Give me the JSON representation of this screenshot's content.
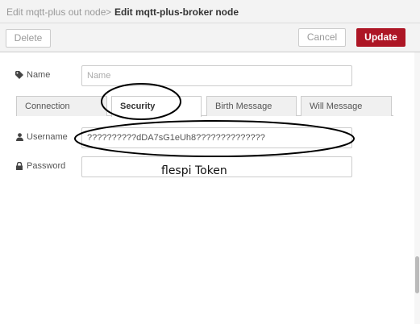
{
  "header": {
    "breadcrumb_prev": "Edit mqtt-plus out node",
    "separator": ">",
    "title": "Edit mqtt-plus-broker node"
  },
  "toolbar": {
    "delete_label": "Delete",
    "cancel_label": "Cancel",
    "update_label": "Update",
    "update_color": "#ad1625"
  },
  "form": {
    "name": {
      "label": "Name",
      "placeholder": "Name",
      "icon": "tag-icon"
    },
    "tabs": [
      {
        "label": "Connection",
        "active": false
      },
      {
        "label": "Security",
        "active": true
      },
      {
        "label": "Birth Message",
        "active": false
      },
      {
        "label": "Will Message",
        "active": false
      }
    ],
    "username": {
      "label": "Username",
      "value": "??????????dDA7sG1eUh8??????????????",
      "icon": "user-icon"
    },
    "password": {
      "label": "Password",
      "value": "",
      "icon": "lock-icon"
    }
  },
  "annotations": {
    "token_note": "flespi Token"
  }
}
